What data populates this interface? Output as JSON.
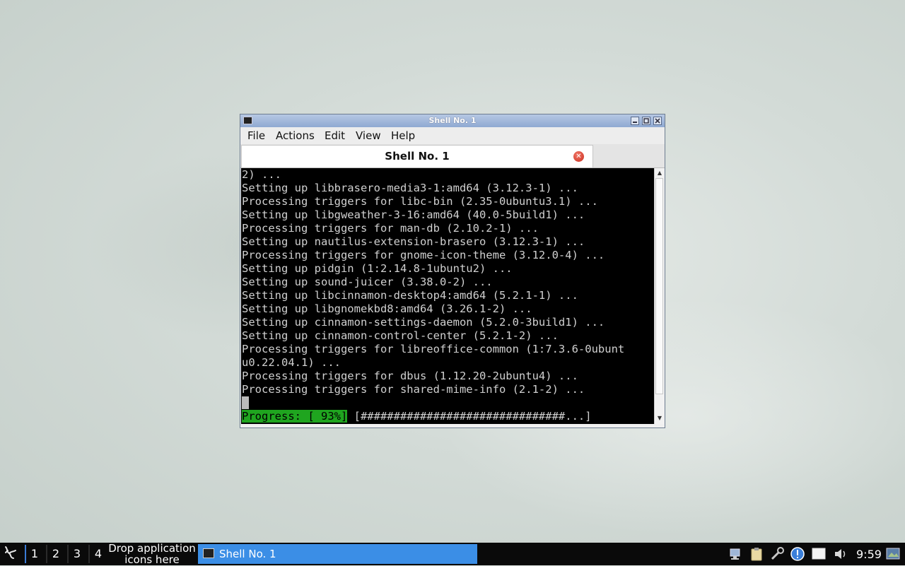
{
  "window": {
    "title": "Shell No. 1",
    "buttons": [
      "minimize",
      "maximize",
      "close"
    ]
  },
  "menubar": {
    "items": [
      "File",
      "Actions",
      "Edit",
      "View",
      "Help"
    ]
  },
  "tab": {
    "label": "Shell No. 1",
    "close_icon": "close-icon"
  },
  "terminal": {
    "lines": [
      "2) ...",
      "Setting up libbrasero-media3-1:amd64 (3.12.3-1) ...",
      "Processing triggers for libc-bin (2.35-0ubuntu3.1) ...",
      "Setting up libgweather-3-16:amd64 (40.0-5build1) ...",
      "Processing triggers for man-db (2.10.2-1) ...",
      "Setting up nautilus-extension-brasero (3.12.3-1) ...",
      "Processing triggers for gnome-icon-theme (3.12.0-4) ...",
      "Setting up pidgin (1:2.14.8-1ubuntu2) ...",
      "Setting up sound-juicer (3.38.0-2) ...",
      "Setting up libcinnamon-desktop4:amd64 (5.2.1-1) ...",
      "Setting up libgnomekbd8:amd64 (3.26.1-2) ...",
      "Setting up cinnamon-settings-daemon (5.2.0-3build1) ...",
      "Setting up cinnamon-control-center (5.2.1-2) ...",
      "Processing triggers for libreoffice-common (1:7.3.6-0ubunt",
      "u0.22.04.1) ...",
      "Processing triggers for dbus (1.12.20-2ubuntu4) ...",
      "Processing triggers for shared-mime-info (2.1-2) ..."
    ],
    "progress_label": "Progress: [ 93%]",
    "progress_bar": " [###############################...]"
  },
  "taskbar": {
    "menu_icon": "menu-icon",
    "workspaces": [
      "1",
      "2",
      "3",
      "4"
    ],
    "drop_label": "Drop application icons here",
    "task_label": "Shell No. 1",
    "tray_icons": [
      "network-icon",
      "clipboard-icon",
      "tools-icon",
      "notification-icon",
      "display-icon",
      "volume-icon"
    ],
    "clock": "9:59"
  }
}
